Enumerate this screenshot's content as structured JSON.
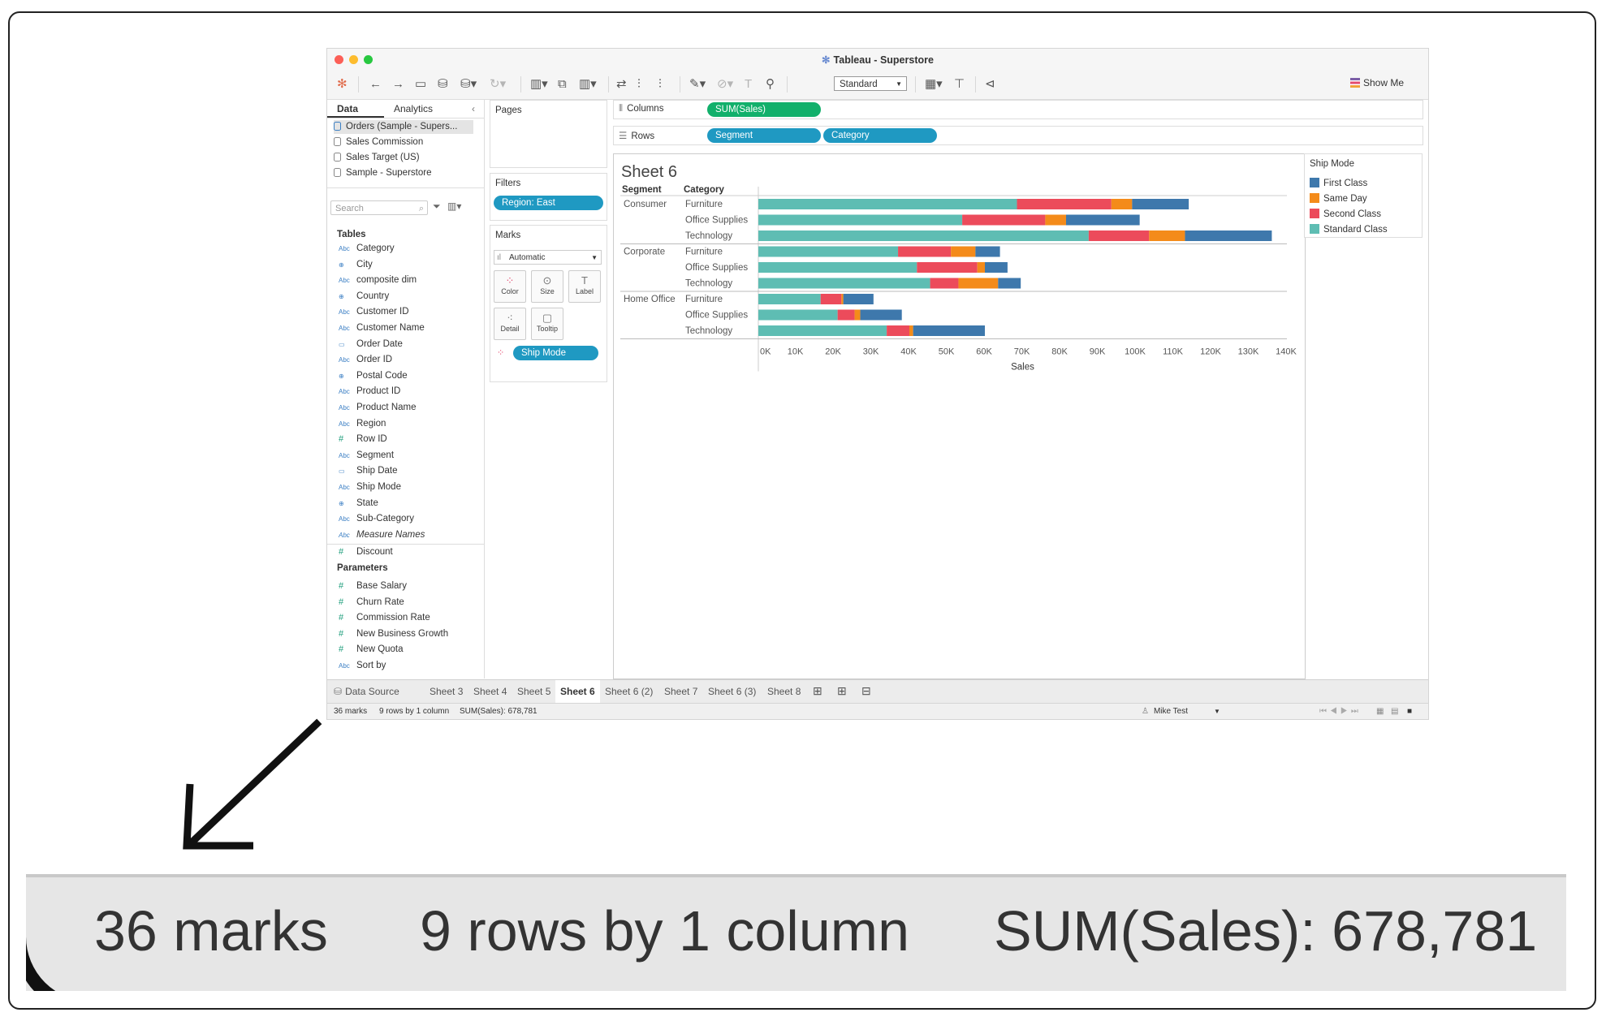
{
  "window": {
    "title": "Tableau - Superstore",
    "logo": "tableau-logo"
  },
  "toolbar": {
    "standard_label": "Standard",
    "show_me_label": "Show Me"
  },
  "data_pane": {
    "tabs": [
      "Data",
      "Analytics"
    ],
    "sources": [
      "Orders (Sample - Supers...",
      "Sales Commission",
      "Sales Target (US)",
      "Sample - Superstore"
    ],
    "search_placeholder": "Search",
    "tables_header": "Tables",
    "fields": [
      {
        "type": "Abc",
        "name": "Category"
      },
      {
        "type": "geo",
        "name": "City"
      },
      {
        "type": "Abc",
        "name": "composite dim"
      },
      {
        "type": "geo",
        "name": "Country"
      },
      {
        "type": "Abc",
        "name": "Customer ID"
      },
      {
        "type": "Abc",
        "name": "Customer Name"
      },
      {
        "type": "date",
        "name": "Order Date"
      },
      {
        "type": "Abc",
        "name": "Order ID"
      },
      {
        "type": "geo",
        "name": "Postal Code"
      },
      {
        "type": "Abc",
        "name": "Product ID"
      },
      {
        "type": "Abc",
        "name": "Product Name"
      },
      {
        "type": "Abc",
        "name": "Region"
      },
      {
        "type": "#",
        "name": "Row ID"
      },
      {
        "type": "Abc",
        "name": "Segment"
      },
      {
        "type": "date",
        "name": "Ship Date"
      },
      {
        "type": "Abc",
        "name": "Ship Mode"
      },
      {
        "type": "geo",
        "name": "State"
      },
      {
        "type": "Abc",
        "name": "Sub-Category"
      },
      {
        "type": "Abc",
        "name": "Measure Names"
      },
      {
        "type": "#",
        "name": "Discount"
      }
    ],
    "parameters_header": "Parameters",
    "parameters": [
      {
        "type": "#",
        "name": "Base Salary"
      },
      {
        "type": "#",
        "name": "Churn Rate"
      },
      {
        "type": "#",
        "name": "Commission Rate"
      },
      {
        "type": "#",
        "name": "New Business Growth"
      },
      {
        "type": "#",
        "name": "New Quota"
      },
      {
        "type": "Abc",
        "name": "Sort by"
      }
    ]
  },
  "shelves": {
    "pages_label": "Pages",
    "filters_label": "Filters",
    "filter_pill": "Region: East",
    "marks_label": "Marks",
    "mark_type": "Automatic",
    "mark_buttons": [
      "Color",
      "Size",
      "Label",
      "Detail",
      "Tooltip"
    ],
    "color_pill": "Ship Mode",
    "columns_label": "Columns",
    "columns_pill": "SUM(Sales)",
    "rows_label": "Rows",
    "rows_pills": [
      "Segment",
      "Category"
    ]
  },
  "sheet": {
    "title": "Sheet 6"
  },
  "chart_data": {
    "type": "bar",
    "orientation": "horizontal",
    "stacked": true,
    "row_headers": [
      "Segment",
      "Category"
    ],
    "segments": [
      "Consumer",
      "Corporate",
      "Home Office"
    ],
    "categories": [
      "Furniture",
      "Office Supplies",
      "Technology",
      "Furniture",
      "Office Supplies",
      "Technology",
      "Furniture",
      "Office Supplies",
      "Technology"
    ],
    "series": [
      {
        "name": "Standard Class",
        "color": "#5ebdb3",
        "values": [
          68500,
          54000,
          87500,
          37000,
          42000,
          45500,
          16500,
          21000,
          34000
        ]
      },
      {
        "name": "Second Class",
        "color": "#ec4b5b",
        "values": [
          25000,
          22000,
          16000,
          14000,
          16000,
          7500,
          5500,
          4500,
          6000
        ]
      },
      {
        "name": "Same Day",
        "color": "#f48b1a",
        "values": [
          5500,
          5500,
          9500,
          6500,
          2000,
          10500,
          500,
          1500,
          1000
        ]
      },
      {
        "name": "First Class",
        "color": "#3e78ac",
        "values": [
          15000,
          19500,
          23000,
          6500,
          6000,
          6000,
          8000,
          11000,
          19000
        ]
      }
    ],
    "xlabel": "Sales",
    "xticks": [
      "0K",
      "10K",
      "20K",
      "30K",
      "40K",
      "50K",
      "60K",
      "70K",
      "80K",
      "90K",
      "100K",
      "110K",
      "120K",
      "130K",
      "140K"
    ],
    "xlim": [
      0,
      140000
    ],
    "legend_title": "Ship Mode",
    "legend_order": [
      "First Class",
      "Same Day",
      "Second Class",
      "Standard Class"
    ],
    "legend_position": "right"
  },
  "sheet_tabs": {
    "data_source": "Data Source",
    "tabs": [
      "Sheet 3",
      "Sheet 4",
      "Sheet 5",
      "Sheet 6",
      "Sheet 6 (2)",
      "Sheet 7",
      "Sheet 6 (3)",
      "Sheet 8"
    ],
    "active": "Sheet 6"
  },
  "status_bar": {
    "marks": "36 marks",
    "dims": "9 rows by 1 column",
    "sum": "SUM(Sales): 678,781",
    "user": "Mike Test"
  },
  "zoom": {
    "marks": "36 marks",
    "dims": "9 rows by 1 column",
    "sum": "SUM(Sales): 678,781"
  }
}
